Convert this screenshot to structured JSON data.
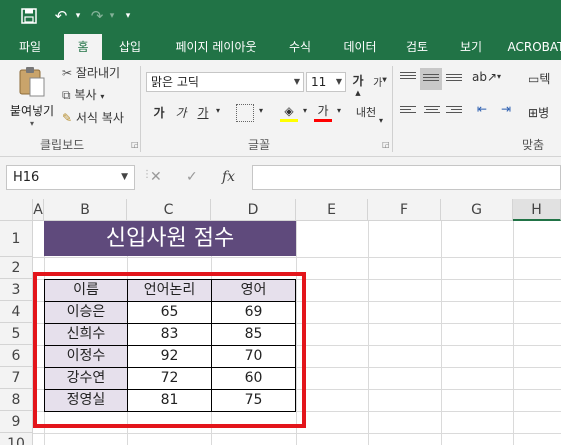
{
  "qat": {
    "save_icon": "save-icon",
    "undo_icon": "undo-icon",
    "redo_icon": "redo-icon",
    "customize_icon": "customize-qat-icon"
  },
  "tabs": [
    "파일",
    "홈",
    "삽입",
    "페이지 레이아웃",
    "수식",
    "데이터",
    "검토",
    "보기",
    "ACROBAT"
  ],
  "active_tab": "홈",
  "ribbon": {
    "paste_label": "붙여넣기",
    "cut_label": "잘라내기",
    "copy_label": "복사",
    "format_painter_label": "서식 복사",
    "clipboard_group": "클립보드",
    "font_name": "맑은 고딕",
    "font_size": "11",
    "font_group": "글꼴",
    "bold_label": "가",
    "italic_label": "가",
    "underline_label": "가",
    "grow_font_label": "가",
    "shrink_font_label": "가",
    "font_color_label": "가",
    "phonetic_label": "내천",
    "alignment_group": "맞춤",
    "wrap_label": "텍",
    "merge_label": "병"
  },
  "formula_bar": {
    "name_box": "H16",
    "fx_label": "fx",
    "cancel": "✕",
    "enter": "✓",
    "formula": ""
  },
  "columns": [
    "A",
    "B",
    "C",
    "D",
    "E",
    "F",
    "G",
    "H"
  ],
  "rows": [
    "1",
    "2",
    "3",
    "4",
    "5",
    "6",
    "7",
    "8",
    "9",
    "10"
  ],
  "sheet": {
    "title": "신입사원 점수",
    "headers": [
      "이름",
      "언어논리",
      "영어"
    ],
    "table": [
      [
        "이승은",
        "65",
        "69"
      ],
      [
        "신희수",
        "83",
        "85"
      ],
      [
        "이정수",
        "92",
        "70"
      ],
      [
        "강수연",
        "72",
        "60"
      ],
      [
        "정영실",
        "81",
        "75"
      ]
    ]
  },
  "colors": {
    "excel_green": "#217346",
    "title_fill": "#5f4a7c",
    "name_fill": "#e6e0ec",
    "highlight_border": "#e3151b"
  }
}
